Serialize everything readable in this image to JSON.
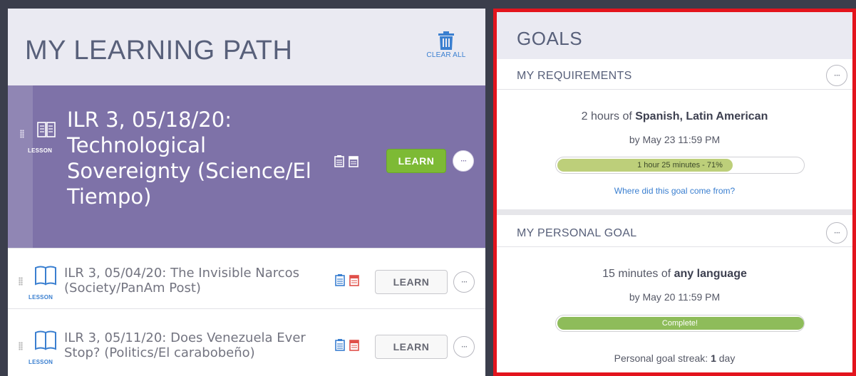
{
  "learning_path": {
    "title": "MY LEARNING PATH",
    "clear_all_label": "CLEAR ALL",
    "lessons": [
      {
        "title": "ILR 3, 05/18/20: Technological Sovereignty (Science/El Tiempo)",
        "type_label": "LESSON",
        "button_label": "LEARN",
        "more_label": "···",
        "active": true
      },
      {
        "title": "ILR 3, 05/04/20: The Invisible Narcos (Society/PanAm Post)",
        "type_label": "LESSON",
        "button_label": "LEARN",
        "more_label": "···",
        "active": false
      },
      {
        "title": "ILR 3, 05/11/20: Does Venezuela Ever Stop? (Politics/El carabobeño)",
        "type_label": "LESSON",
        "button_label": "LEARN",
        "more_label": "···",
        "active": false
      }
    ]
  },
  "goals": {
    "title": "GOALS",
    "requirements": {
      "label": "MY REQUIREMENTS",
      "more_label": "···",
      "amount": "2 hours of ",
      "subject": "Spanish, Latin American",
      "deadline": "by May 23 11:59 PM",
      "progress_text": "1 hour 25 minutes - 71%",
      "progress_fraction": 0.71,
      "link_text": "Where did this goal come from?"
    },
    "personal": {
      "label": "MY PERSONAL GOAL",
      "more_label": "···",
      "amount": "15 minutes of ",
      "subject": "any language",
      "deadline": "by May 20 11:59 PM",
      "progress_text": "Complete!",
      "progress_fraction": 1.0,
      "streak_label": "Personal goal streak: ",
      "streak_value": "1",
      "streak_unit": " day"
    }
  },
  "colors": {
    "active_row": "#7e72a8",
    "learn_active": "#7dba35",
    "link": "#3a7fd0",
    "highlight_border": "#e3141d"
  }
}
